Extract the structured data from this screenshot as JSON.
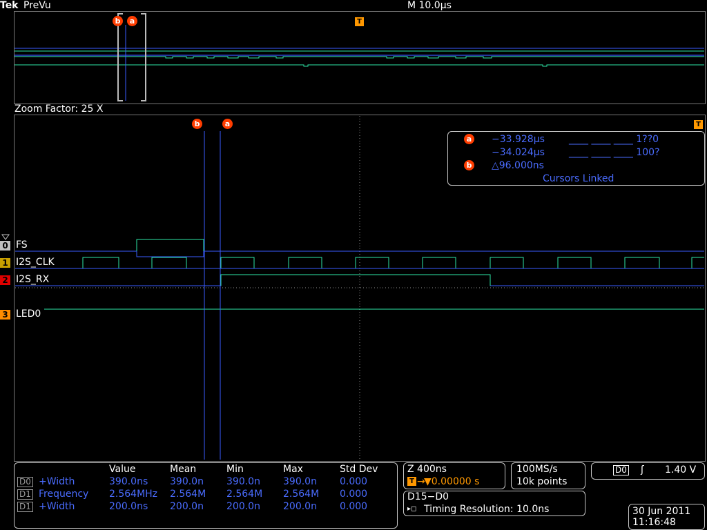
{
  "header": {
    "brand": "Tek",
    "mode": "PreVu",
    "timebase": "M 10.0µs"
  },
  "zoom": {
    "label": "Zoom Factor: 25 X"
  },
  "cursors": {
    "a_label": "a",
    "b_label": "b",
    "trigger_label": "T",
    "a_time": "−33.928µs",
    "a_bits": "____ ____ ____ 1??0",
    "b_time": "−34.024µs",
    "b_bits": "____ ____ ____ 100?",
    "delta": "△96.000ns",
    "linked": "Cursors Linked"
  },
  "channels": [
    {
      "num": "0",
      "name": "FS",
      "color": "#c0c0c0"
    },
    {
      "num": "1",
      "name": "I2S_CLK",
      "color": "#c8a000"
    },
    {
      "num": "2",
      "name": "I2S_RX",
      "color": "#e00000"
    },
    {
      "num": "3",
      "name": "LED0",
      "color": "#ff8c00"
    }
  ],
  "measurements": {
    "headers": [
      "Value",
      "Mean",
      "Min",
      "Max",
      "Std Dev"
    ],
    "rows": [
      {
        "src": "D0",
        "label": "+Width",
        "value": "390.0ns",
        "mean": "390.0n",
        "min": "390.0n",
        "max": "390.0n",
        "std": "0.000"
      },
      {
        "src": "D1",
        "label": "Frequency",
        "value": "2.564MHz",
        "mean": "2.564M",
        "min": "2.564M",
        "max": "2.564M",
        "std": "0.000"
      },
      {
        "src": "D1",
        "label": "+Width",
        "value": "200.0ns",
        "mean": "200.0n",
        "min": "200.0n",
        "max": "200.0n",
        "std": "0.000"
      }
    ]
  },
  "zoom_panel": {
    "scale": "Z 400ns",
    "position": "▼0.00000 s"
  },
  "acq": {
    "rate": "100MS/s",
    "points": "10k points"
  },
  "trigger": {
    "source": "D0",
    "slope": "ʃ",
    "level": "1.40 V"
  },
  "digital": {
    "title": "D15−D0",
    "resolution": "Timing Resolution: 10.0ns"
  },
  "datetime": {
    "date": "30 Jun  2011",
    "time": "11:16:48"
  },
  "colors": {
    "waveform": "#2ee8a8",
    "cursor": "#3a5bff",
    "text_blue": "#4a6cff",
    "cursor_badge": "#ff3d00",
    "trigger_badge": "#ff9800"
  }
}
